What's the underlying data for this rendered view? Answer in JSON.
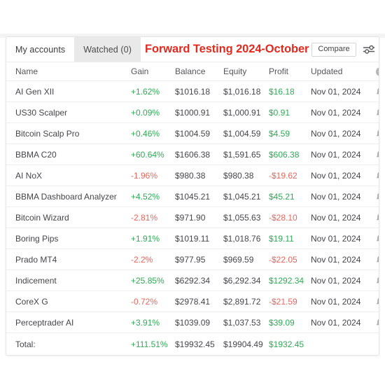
{
  "header": {
    "tabs": [
      {
        "label": "My accounts",
        "active": true
      },
      {
        "label": "Watched (0)",
        "active": false
      }
    ],
    "title": "Forward Testing  2024-October",
    "compare_label": "Compare",
    "settings_icon": "sliders-icon",
    "info_icon": "info-icon"
  },
  "table": {
    "columns": [
      "Name",
      "Gain",
      "Balance",
      "Equity",
      "Profit",
      "Updated",
      ""
    ],
    "rows": [
      {
        "name": "AI Gen XII",
        "gain": "+1.62%",
        "gain_sign": "pos",
        "balance": "$1016.18",
        "equity": "$1,016.18",
        "profit": "$16.18",
        "profit_sign": "pos",
        "updated": "Nov 01, 2024"
      },
      {
        "name": "US30 Scalper",
        "gain": "+0.09%",
        "gain_sign": "pos",
        "balance": "$1000.91",
        "equity": "$1,000.91",
        "profit": "$0.91",
        "profit_sign": "pos",
        "updated": "Nov 01, 2024"
      },
      {
        "name": "Bitcoin Scalp Pro",
        "gain": "+0.46%",
        "gain_sign": "pos",
        "balance": "$1004.59",
        "equity": "$1,004.59",
        "profit": "$4.59",
        "profit_sign": "pos",
        "updated": "Nov 01, 2024"
      },
      {
        "name": "BBMA C20",
        "gain": "+60.64%",
        "gain_sign": "pos",
        "balance": "$1606.38",
        "equity": "$1,591.65",
        "profit": "$606.38",
        "profit_sign": "pos",
        "updated": "Nov 01, 2024"
      },
      {
        "name": "AI NoX",
        "gain": "-1.96%",
        "gain_sign": "neg",
        "balance": "$980.38",
        "equity": "$980.38",
        "profit": "-$19.62",
        "profit_sign": "neg",
        "updated": "Nov 01, 2024"
      },
      {
        "name": "BBMA Dashboard Analyzer",
        "gain": "+4.52%",
        "gain_sign": "pos",
        "balance": "$1045.21",
        "equity": "$1,045.21",
        "profit": "$45.21",
        "profit_sign": "pos",
        "updated": "Nov 01, 2024"
      },
      {
        "name": "Bitcoin Wizard",
        "gain": "-2.81%",
        "gain_sign": "neg",
        "balance": "$971.90",
        "equity": "$1,055.63",
        "profit": "-$28.10",
        "profit_sign": "neg",
        "updated": "Nov 01, 2024"
      },
      {
        "name": "Boring Pips",
        "gain": "+1.91%",
        "gain_sign": "pos",
        "balance": "$1019.11",
        "equity": "$1,018.76",
        "profit": "$19.11",
        "profit_sign": "pos",
        "updated": "Nov 01, 2024"
      },
      {
        "name": "Prado MT4",
        "gain": "-2.2%",
        "gain_sign": "neg",
        "balance": "$977.95",
        "equity": "$969.59",
        "profit": "-$22.05",
        "profit_sign": "neg",
        "updated": "Nov 01, 2024"
      },
      {
        "name": "Indicement",
        "gain": "+25.85%",
        "gain_sign": "pos",
        "balance": "$6292.34",
        "equity": "$6,292.34",
        "profit": "$1292.34",
        "profit_sign": "pos",
        "updated": "Nov 01, 2024"
      },
      {
        "name": "CoreX G",
        "gain": "-0.72%",
        "gain_sign": "neg",
        "balance": "$2978.41",
        "equity": "$2,891.72",
        "profit": "-$21.59",
        "profit_sign": "neg",
        "updated": "Nov 01, 2024"
      },
      {
        "name": "Perceptrader AI",
        "gain": "+3.91%",
        "gain_sign": "pos",
        "balance": "$1039.09",
        "equity": "$1,037.53",
        "profit": "$39.09",
        "profit_sign": "pos",
        "updated": "Nov 01, 2024"
      }
    ],
    "total": {
      "name": "Total:",
      "gain": "+111.51%",
      "gain_sign": "pos",
      "balance": "$19932.45",
      "equity": "$19904.49",
      "profit": "$1932.45",
      "profit_sign": "pos",
      "updated": ""
    },
    "row_icon": "bell-icon"
  },
  "colors": {
    "positive": "#2faa55",
    "negative": "#e2685f",
    "title_red": "#e02b20",
    "text": "#45464a"
  }
}
